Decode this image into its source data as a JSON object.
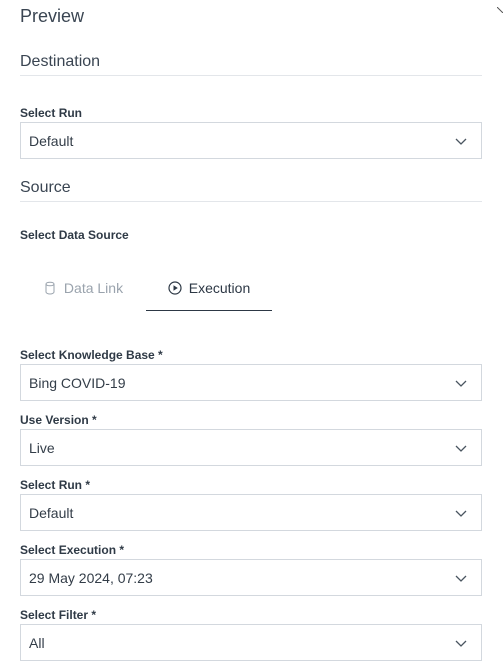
{
  "page": {
    "title": "Preview"
  },
  "destination": {
    "section_title": "Destination",
    "select_run": {
      "label": "Select Run",
      "value": "Default"
    }
  },
  "source": {
    "section_title": "Source",
    "data_source_label": "Select Data Source",
    "tabs": [
      {
        "label": "Data Link",
        "icon": "database-icon",
        "active": false
      },
      {
        "label": "Execution",
        "icon": "play-circle-icon",
        "active": true
      }
    ],
    "fields": {
      "knowledge_base": {
        "label": "Select Knowledge Base *",
        "value": "Bing COVID-19"
      },
      "version": {
        "label": "Use Version *",
        "value": "Live"
      },
      "run": {
        "label": "Select Run *",
        "value": "Default"
      },
      "execution": {
        "label": "Select Execution *",
        "value": "29 May 2024, 07:23"
      },
      "filter": {
        "label": "Select Filter *",
        "value": "All"
      }
    }
  },
  "colors": {
    "text": "#2b3440",
    "muted_tab": "#9aa3ad",
    "border": "#d3d8de",
    "rule": "#e3e6ea"
  }
}
